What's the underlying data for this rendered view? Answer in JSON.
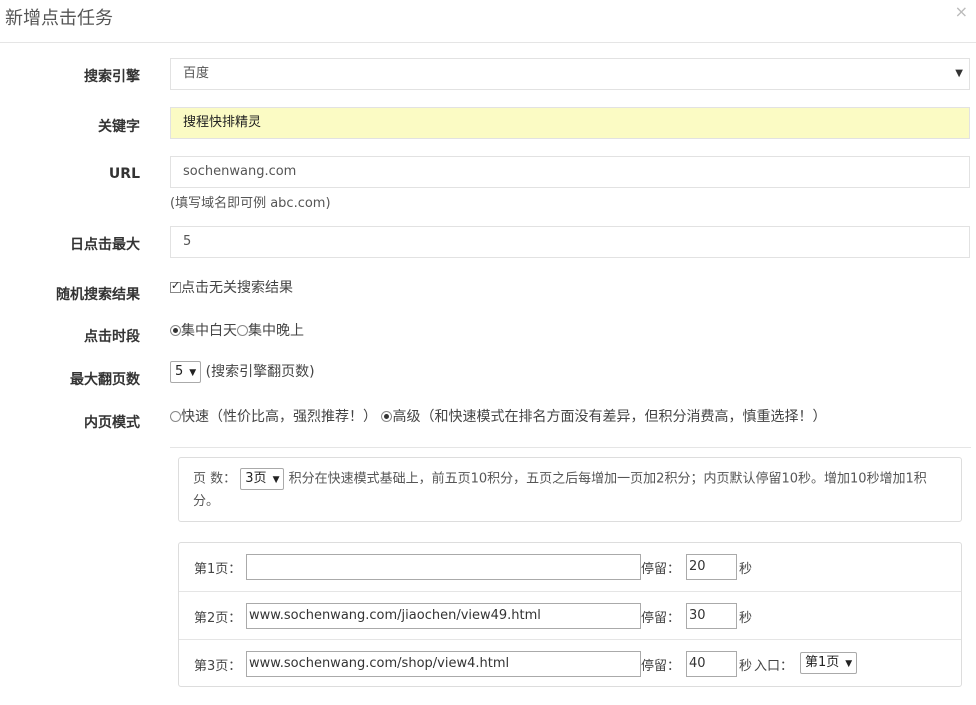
{
  "modal": {
    "title": "新增点击任务",
    "close": "×"
  },
  "form": {
    "engine": {
      "label": "搜索引擎",
      "value": "百度"
    },
    "keyword": {
      "label": "关键字",
      "value": "搜程快排精灵"
    },
    "url": {
      "label": "URL",
      "value": "sochenwang.com",
      "help": "(填写域名即可例 abc.com)"
    },
    "daily_max": {
      "label": "日点击最大",
      "value": "5"
    },
    "random_results": {
      "label": "随机搜索结果",
      "checkbox_label": "点击无关搜索结果",
      "checked": true
    },
    "click_period": {
      "label": "点击时段",
      "options": [
        "集中白天",
        "集中晚上"
      ],
      "selected": "集中白天"
    },
    "max_pages": {
      "label": "最大翻页数",
      "value": "5",
      "note": "(搜索引擎翻页数)"
    },
    "inner_mode": {
      "label": "内页模式",
      "options": [
        "快速（性价比高，强烈推荐！）",
        "高级（和快速模式在排名方面没有差异，但积分消费高，慎重选择！）"
      ],
      "selected": "高级"
    }
  },
  "advanced": {
    "pages_label": "页 数：",
    "pages_value": "3页",
    "description": "积分在快速模式基础上，前五页10积分，五页之后每增加一页加2积分；内页默认停留10秒。增加10秒增加1积分。",
    "stay_label": "停留：",
    "sec_label": "秒",
    "entry_label": "入口：",
    "rows": [
      {
        "label": "第1页：",
        "url": "",
        "stay": "20"
      },
      {
        "label": "第2页：",
        "url": "www.sochenwang.com/jiaochen/view49.html",
        "stay": "30"
      },
      {
        "label": "第3页：",
        "url": "www.sochenwang.com/shop/view4.html",
        "stay": "40",
        "entry": "第1页"
      }
    ]
  }
}
